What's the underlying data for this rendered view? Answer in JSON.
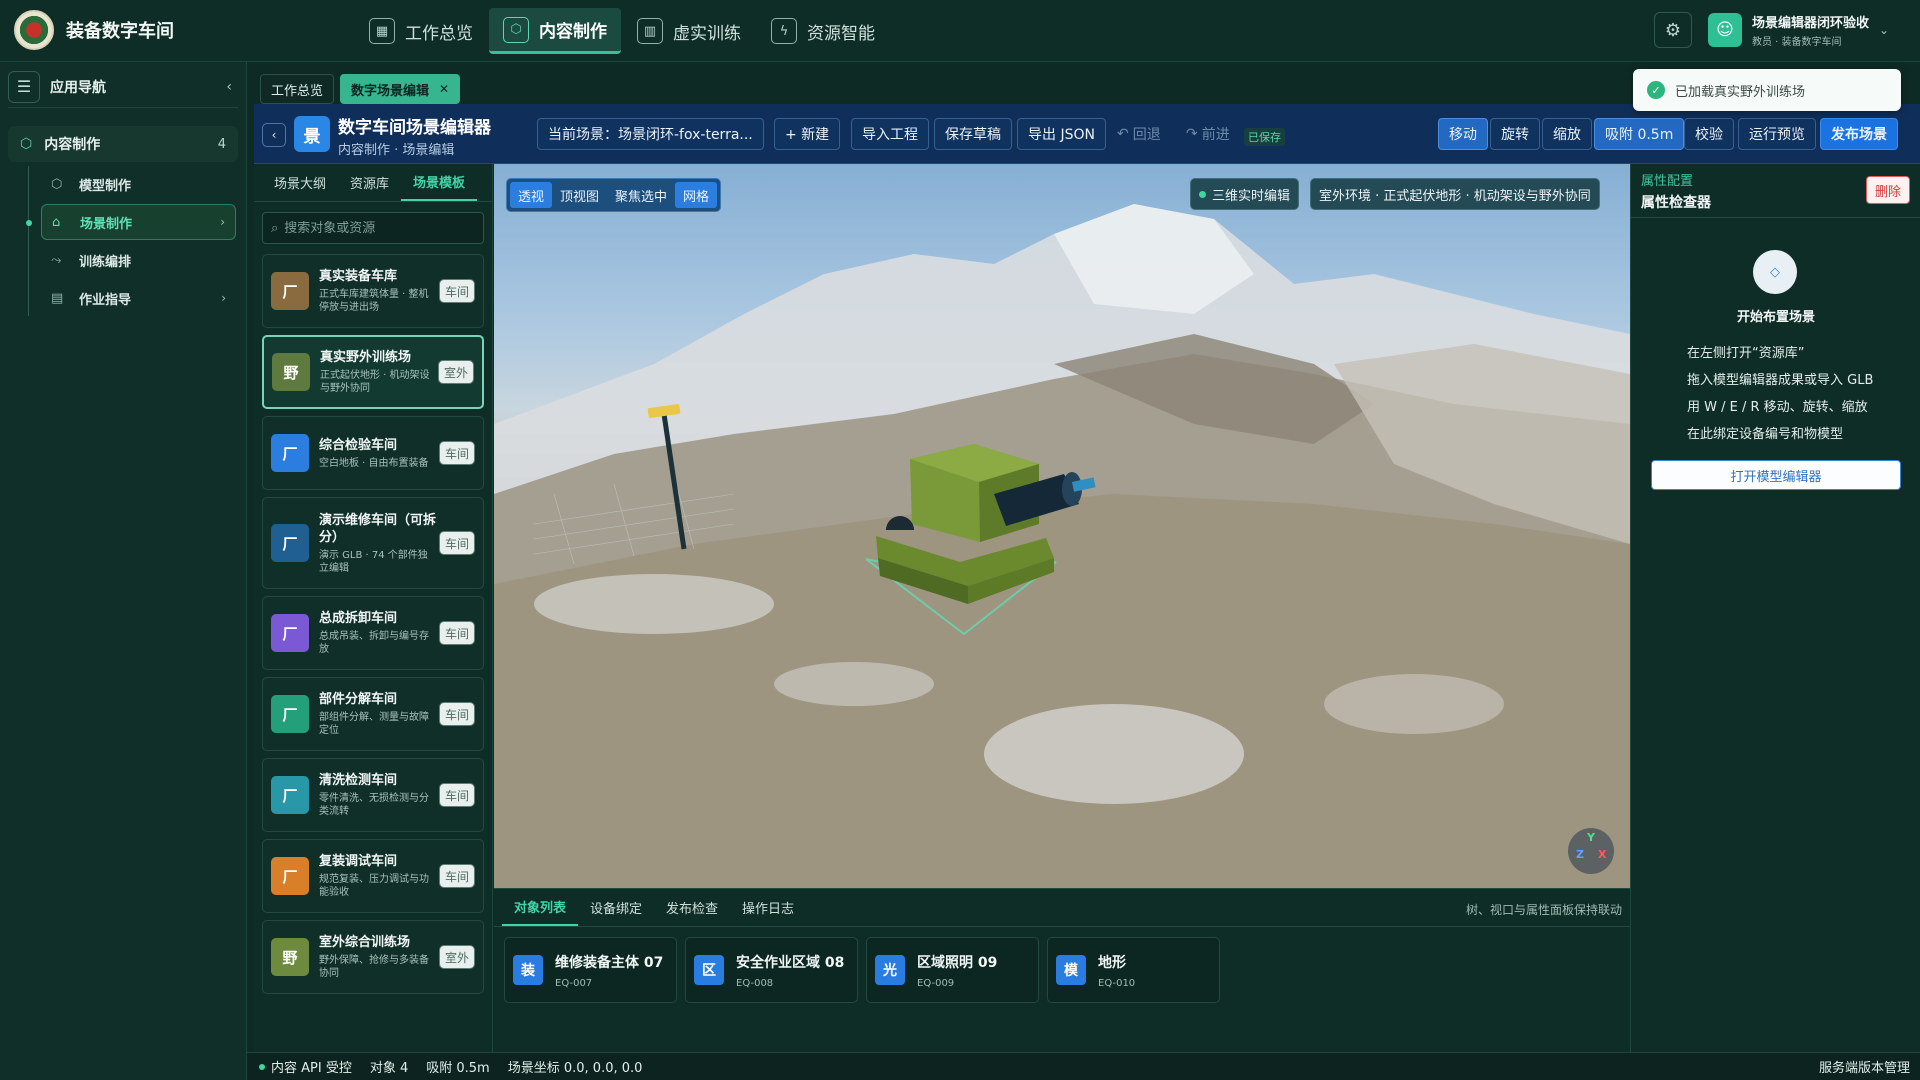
{
  "app": {
    "title": "装备数字车间"
  },
  "topnav": {
    "items": [
      {
        "label": "工作总览",
        "icon": "grid-icon"
      },
      {
        "label": "内容制作",
        "icon": "cube-icon"
      },
      {
        "label": "虚实训练",
        "icon": "book-icon"
      },
      {
        "label": "资源智能",
        "icon": "lightning-icon"
      }
    ],
    "active_index": 1
  },
  "user": {
    "name": "场景编辑器闭环验收",
    "role": "教员 · 装备数字车间"
  },
  "appnav": {
    "title": "应用导航",
    "group": {
      "label": "内容制作",
      "count": "4"
    },
    "items": [
      {
        "label": "模型制作",
        "icon": "cube-icon"
      },
      {
        "label": "场景制作",
        "icon": "home-icon"
      },
      {
        "label": "训练编排",
        "icon": "flow-icon"
      },
      {
        "label": "作业指导",
        "icon": "document-icon"
      }
    ]
  },
  "tabs": [
    {
      "label": "工作总览"
    },
    {
      "label": "数字场景编辑"
    }
  ],
  "editor": {
    "logo": "景",
    "title": "数字车间场景编辑器",
    "breadcrumb": "内容制作 · 场景编辑",
    "current_scene": "当前场景：场景闭环-fox-terra...",
    "new_label": "+ 新建",
    "import_label": "导入工程",
    "save_label": "保存草稿",
    "export_label": "导出 JSON",
    "undo_label": "回退",
    "redo_label": "前进",
    "saved_badge": "已保存",
    "move_label": "移动",
    "rotate_label": "旋转",
    "scale_label": "缩放",
    "snap_label": "吸附 0.5m",
    "check_label": "校验",
    "preview_label": "运行预览",
    "publish_label": "发布场景"
  },
  "resource_panel": {
    "tabs": [
      "场景大纲",
      "资源库",
      "场景模板"
    ],
    "active_tab": 2,
    "search_placeholder": "搜索对象或资源",
    "items": [
      {
        "badge": "厂",
        "color": "#8a6a3f",
        "name": "真实装备车库",
        "desc": "正式车库建筑体量 · 整机停放与进出场",
        "tag": "车间"
      },
      {
        "badge": "野",
        "color": "#5f7a3e",
        "name": "真实野外训练场",
        "desc": "正式起伏地形 · 机动架设与野外协同",
        "tag": "室外"
      },
      {
        "badge": "厂",
        "color": "#2b7ee0",
        "name": "综合检验车间",
        "desc": "空白地板 · 自由布置装备",
        "tag": "车间"
      },
      {
        "badge": "厂",
        "color": "#1f5f91",
        "name": "演示维修车间（可拆分）",
        "desc": "演示 GLB · 74 个部件独立编辑",
        "tag": "车间"
      },
      {
        "badge": "厂",
        "color": "#7b58d4",
        "name": "总成拆卸车间",
        "desc": "总成吊装、拆卸与编号存放",
        "tag": "车间"
      },
      {
        "badge": "厂",
        "color": "#23a079",
        "name": "部件分解车间",
        "desc": "部组件分解、测量与故障定位",
        "tag": "车间"
      },
      {
        "badge": "厂",
        "color": "#2897a8",
        "name": "清洗检测车间",
        "desc": "零件清洗、无损检测与分类流转",
        "tag": "车间"
      },
      {
        "badge": "厂",
        "color": "#d97f2a",
        "name": "复装调试车间",
        "desc": "规范复装、压力调试与功能验收",
        "tag": "车间"
      },
      {
        "badge": "野",
        "color": "#6d8a3f",
        "name": "室外综合训练场",
        "desc": "野外保障、抢修与多装备协同",
        "tag": "室外"
      }
    ],
    "active_index": 1
  },
  "viewport": {
    "modes": [
      "透视",
      "顶视图",
      "聚焦选中",
      "网格"
    ],
    "active_modes": [
      0,
      3
    ],
    "live_chip": "三维实时编辑",
    "env_chip": "室外环境 · 正式起伏地形 · 机动架设与野外协同",
    "gizmo": {
      "y": "Y",
      "z": "Z",
      "x": "X"
    }
  },
  "bottom_panel": {
    "tabs": [
      "对象列表",
      "设备绑定",
      "发布检查",
      "操作日志"
    ],
    "active_tab": 0,
    "hint": "树、视口与属性面板保持联动",
    "objects": [
      {
        "badge": "装",
        "name": "维修装备主体 07",
        "code": "EQ-007"
      },
      {
        "badge": "区",
        "name": "安全作业区域 08",
        "code": "EQ-008"
      },
      {
        "badge": "光",
        "name": "区域照明 09",
        "code": "EQ-009"
      },
      {
        "badge": "模",
        "name": "地形",
        "code": "EQ-010"
      }
    ]
  },
  "inspector": {
    "kicker": "属性配置",
    "title": "属性检查器",
    "delete_label": "删除",
    "empty_title": "开始布置场景",
    "steps": [
      "在左侧打开“资源库”",
      "拖入模型编辑器成果或导入 GLB",
      "用 W / E / R 移动、旋转、缩放",
      "在此绑定设备编号和物模型"
    ],
    "open_label": "打开模型编辑器"
  },
  "status": {
    "api": "内容 API 受控",
    "objects": "对象 4",
    "snap": "吸附 0.5m",
    "coords": "场景坐标 0.0, 0.0, 0.0",
    "right": "服务端版本管理"
  },
  "toast": {
    "text": "已加载真实野外训练场"
  }
}
